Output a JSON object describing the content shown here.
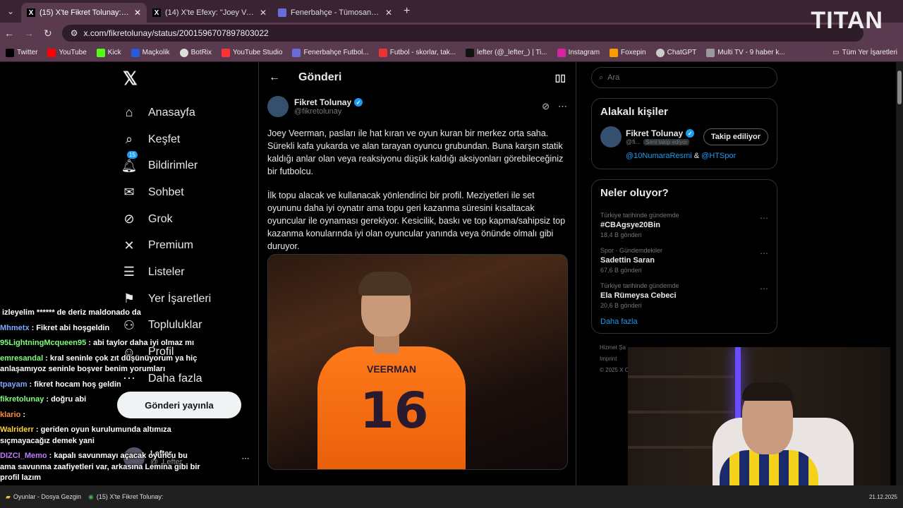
{
  "browser": {
    "tabs": [
      {
        "label": "(15) X'te Fikret Tolunay: \"Joey V",
        "active": true
      },
      {
        "label": "(14) X'te Efexy: \"Joey Veerman",
        "active": false
      },
      {
        "label": "Fenerbahçe - Tümosan Konyasp",
        "active": false
      }
    ],
    "url": "x.com/fikretolunay/status/2001596707897803022",
    "bookmarks": [
      "Twitter",
      "YouTube",
      "Kick",
      "Maçkolik",
      "BotRix",
      "YouTube Studio",
      "Fenerbahçe Futbol...",
      "Futbol - skorlar, tak...",
      "lefter (@_lefter_) | Ti...",
      "Instagram",
      "Foxepin",
      "ChatGPT",
      "Multi TV - 9 haber k..."
    ],
    "all_bookmarks": "Tüm Yer İşaretleri"
  },
  "overlay_logo": "TITAN",
  "nav": {
    "items": [
      "Anasayfa",
      "Keşfet",
      "Bildirimler",
      "Sohbet",
      "Grok",
      "Premium",
      "Listeler",
      "Yer İşaretleri",
      "Topluluklar",
      "Profil",
      "Daha fazla"
    ],
    "badge": "15",
    "post_button": "Gönderi yayınla",
    "account_name": "Lefter",
    "account_handle": "@_Lefter_"
  },
  "post": {
    "header": "Gönderi",
    "author_name": "Fikret Tolunay",
    "author_handle": "@fikretolunay",
    "paragraph1": "Joey Veerman, pasları ile hat kıran ve oyun kuran bir merkez orta saha. Sürekli kafa yukarda ve alan tarayan oyuncu grubundan. Buna karşın statik kaldığı anlar olan veya reaksiyonu düşük kaldığı aksiyonları görebileceğiniz bir futbolcu.",
    "paragraph2": "İlk topu alacak ve kullanacak yönlendirici bir profil. Meziyetleri ile set oyununu daha iyi oynatır ama topu geri kazanma süresini kısaltacak oyuncular ile oynaması gerekiyor. Kesicilik, baskı ve top kapma/sahipsiz top kazanma konularında iyi olan oyuncular yanında veya önünde olmalı gibi duruyor.",
    "jersey_name": "VEERMAN",
    "jersey_number": "16"
  },
  "sidebar": {
    "search_placeholder": "Ara",
    "related_title": "Alakalı kişiler",
    "related_name": "Fikret Tolunay",
    "related_handle": "@fi...",
    "follows_you": "Seni takip ediyor",
    "follow_button": "Takip ediliyor",
    "mention1": "@10NumaraResmi",
    "mention_amp": "&",
    "mention2": "@HTSpor",
    "trends_title": "Neler oluyor?",
    "trends": [
      {
        "context": "Türkiye tarihinde gündemde",
        "name": "#CBAgsye20Bin",
        "count": "18,4 B gönderi"
      },
      {
        "context": "Spor · Gündemdekiler",
        "name": "Sadettin Saran",
        "count": "67,6 B gönderi"
      },
      {
        "context": "Türkiye tarihinde gündemde",
        "name": "Ela Rümeysa Cebeci",
        "count": "20,6 B gönderi"
      }
    ],
    "show_more": "Daha fazla",
    "footer1": "Hizmet Şa",
    "footer2": "Imprint",
    "footer3": "© 2025 X C"
  },
  "chat": [
    {
      "user": "",
      "text": "izleyelim ****** de deriz maldonado da",
      "color": "#ffffff"
    },
    {
      "user": "Mhmetx",
      "text": ": Fikret abi hoşgeldin",
      "color": "#7fa8ff"
    },
    {
      "user": "95LightningMcqueen95",
      "text": ": abi taylor daha iyi olmaz mı",
      "color": "#7dff7d"
    },
    {
      "user": "emresandal",
      "text": ": kral seninle çok zıt düşünüyorum ya hiç anlaşamıyoz seninle boşver benim yorumları",
      "color": "#7dff7d"
    },
    {
      "user": "tpayam",
      "text": ": fikret hocam hoş geldin",
      "color": "#7fa8ff"
    },
    {
      "user": "fikretolunay",
      "text": ": doğru abi",
      "color": "#7dff7d"
    },
    {
      "user": "klario",
      "text": ":",
      "color": "#ff8a3a"
    },
    {
      "user": "Walriderr",
      "text": ": geriden oyun kurulumunda altımıza sıçmayacağız demek yani",
      "color": "#ffd23a"
    },
    {
      "user": "DIZCI_Memo",
      "text": ": kapalı savunmayı açacak oyuncu bu ama savunma zaafiyetleri var, arkasına Lemina gibi bir profil lazım",
      "color": "#c07aff"
    }
  ],
  "taskbar": {
    "item1": "Oyunlar - Dosya Gezgin",
    "item2": "(15) X'te Fikret Tolunay:",
    "date": "21.12.2025"
  },
  "colors": {
    "accent": "#1d9bf0",
    "tab_bar": "#3a2434",
    "toolbar": "#5a3a4f"
  }
}
